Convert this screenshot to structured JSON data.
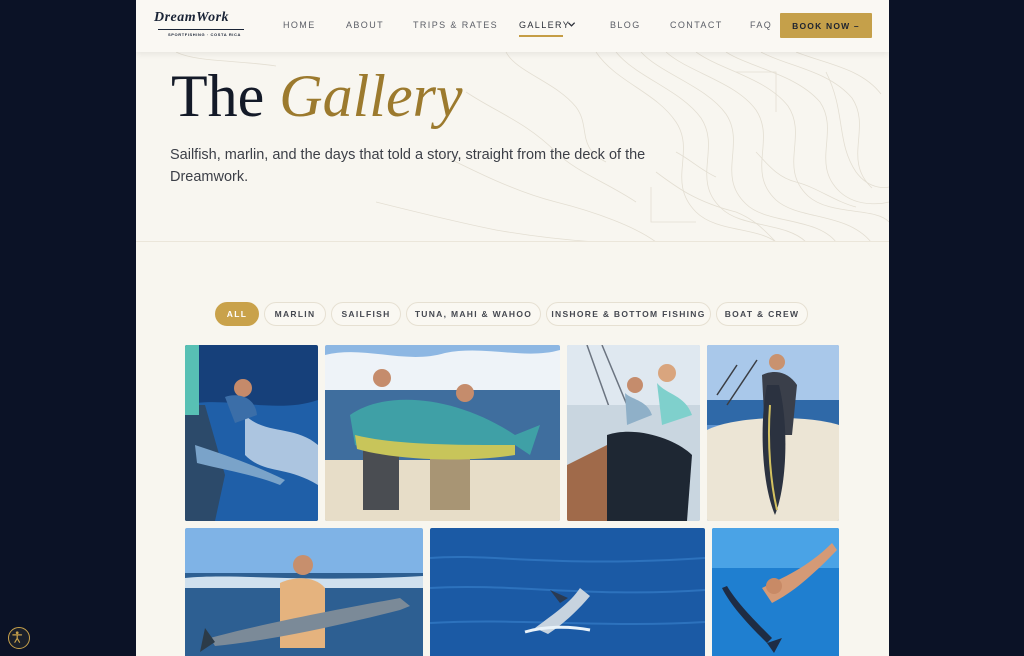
{
  "header": {
    "logo_text": "DreamWork",
    "logo_subtext": "SPORTFISHING · COSTA RICA",
    "nav": [
      "HOME",
      "ABOUT",
      "TRIPS & RATES",
      "GALLERY",
      "BLOG",
      "CONTACT",
      "FAQ"
    ],
    "book_button": "BOOK NOW –"
  },
  "hero": {
    "title_plain": "The",
    "title_accent": "Gallery",
    "subtitle": "Sailfish, marlin, and the days that told a story, straight from the deck of the Dreamwork."
  },
  "filters": {
    "items": [
      "ALL",
      "MARLIN",
      "SAILFISH",
      "TUNA, MAHI & WAHOO",
      "INSHORE & BOTTOM FISHING",
      "BOAT & CREW"
    ],
    "active": "ALL"
  },
  "colors": {
    "gold": "#c9a24b",
    "navy_background": "#0b1226",
    "page_background": "#f8f6ef",
    "title_accent": "#9c7a2e"
  }
}
